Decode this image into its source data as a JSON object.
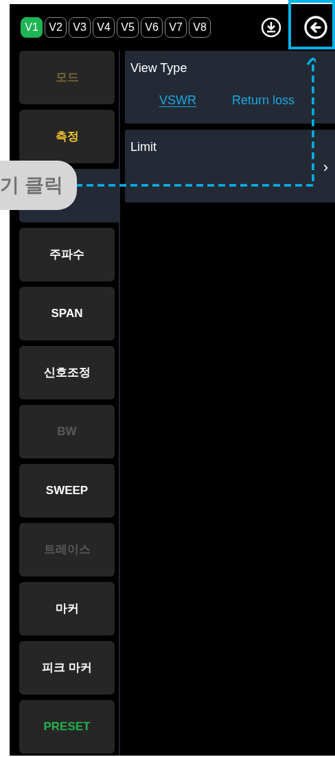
{
  "tabs": [
    {
      "label": "V1",
      "selected": true
    },
    {
      "label": "V2",
      "selected": false
    },
    {
      "label": "V3",
      "selected": false
    },
    {
      "label": "V4",
      "selected": false
    },
    {
      "label": "V5",
      "selected": false
    },
    {
      "label": "V6",
      "selected": false
    },
    {
      "label": "V7",
      "selected": false
    },
    {
      "label": "V8",
      "selected": false
    }
  ],
  "menu": [
    {
      "label": "모드",
      "kind": "accent",
      "disabled": true,
      "selected": false
    },
    {
      "label": "측정",
      "kind": "accent",
      "disabled": false,
      "selected": false
    },
    {
      "kind": "accent",
      "disabled": false,
      "selected": true
    },
    {
      "label": "주파수",
      "kind": "normal",
      "disabled": false,
      "selected": false
    },
    {
      "label": "SPAN",
      "kind": "normal",
      "disabled": false,
      "selected": false
    },
    {
      "label": "신호조정",
      "kind": "normal",
      "disabled": false,
      "selected": false
    },
    {
      "label": "BW",
      "kind": "normal",
      "disabled": true,
      "selected": false
    },
    {
      "label": "SWEEP",
      "kind": "normal",
      "disabled": false,
      "selected": false
    },
    {
      "label": "트레이스",
      "kind": "normal",
      "disabled": true,
      "selected": false
    },
    {
      "label": "마커",
      "kind": "normal",
      "disabled": false,
      "selected": false
    },
    {
      "label": "피크 마커",
      "kind": "normal",
      "disabled": false,
      "selected": false
    },
    {
      "label": "PRESET",
      "kind": "preset",
      "disabled": false,
      "selected": false
    }
  ],
  "panels": [
    {
      "title": "View Type",
      "kind": "options",
      "options": [
        {
          "label": "VSWR",
          "selected": true
        },
        {
          "label": "Return loss",
          "selected": false
        }
      ]
    },
    {
      "title": "Limit",
      "kind": "submenu",
      "chevron": "›"
    }
  ],
  "annotation": {
    "callout": "기 클릭"
  }
}
